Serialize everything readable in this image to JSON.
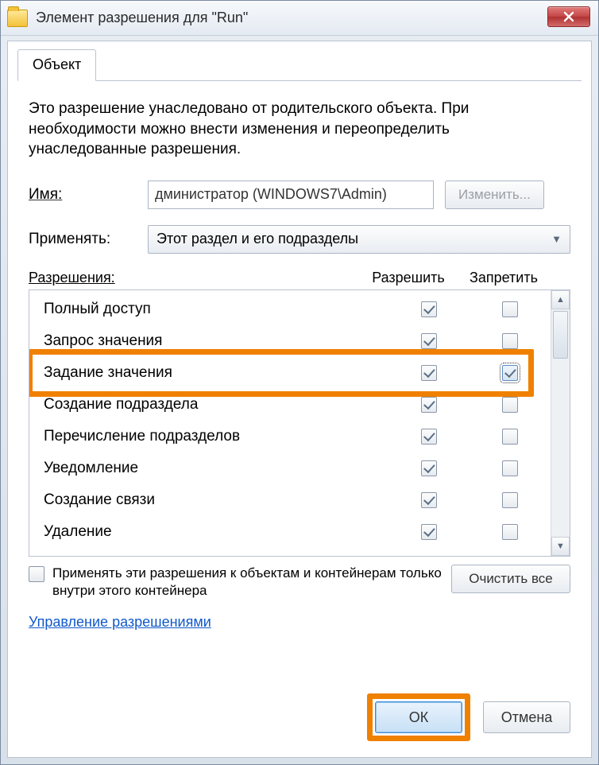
{
  "title": "Элемент разрешения для \"Run\"",
  "tab_label": "Объект",
  "description": "Это разрешение унаследовано от родительского объекта. При необходимости можно внести изменения и переопределить унаследованные разрешения.",
  "name_label": "Имя:",
  "name_value": "дминистратор (WINDOWS7\\Admin)",
  "change_btn": "Изменить...",
  "apply_to_label": "Применять:",
  "apply_to_value": "Этот раздел и его подразделы",
  "perm_header": {
    "name": "Разрешения:",
    "allow": "Разрешить",
    "deny": "Запретить"
  },
  "permissions": [
    {
      "name": "Полный доступ",
      "allow": true,
      "deny": false
    },
    {
      "name": "Запрос значения",
      "allow": true,
      "deny": false
    },
    {
      "name": "Задание значения",
      "allow": true,
      "deny": true,
      "deny_focus": true,
      "highlight": true
    },
    {
      "name": "Создание подраздела",
      "allow": true,
      "deny": false
    },
    {
      "name": "Перечисление подразделов",
      "allow": true,
      "deny": false
    },
    {
      "name": "Уведомление",
      "allow": true,
      "deny": false
    },
    {
      "name": "Создание связи",
      "allow": true,
      "deny": false
    },
    {
      "name": "Удаление",
      "allow": true,
      "deny": false
    }
  ],
  "apply_only": "Применять эти разрешения к объектам и контейнерам только внутри этого контейнера",
  "clear_all": "Очистить все",
  "manage_link": "Управление разрешениями",
  "ok": "ОК",
  "cancel": "Отмена"
}
